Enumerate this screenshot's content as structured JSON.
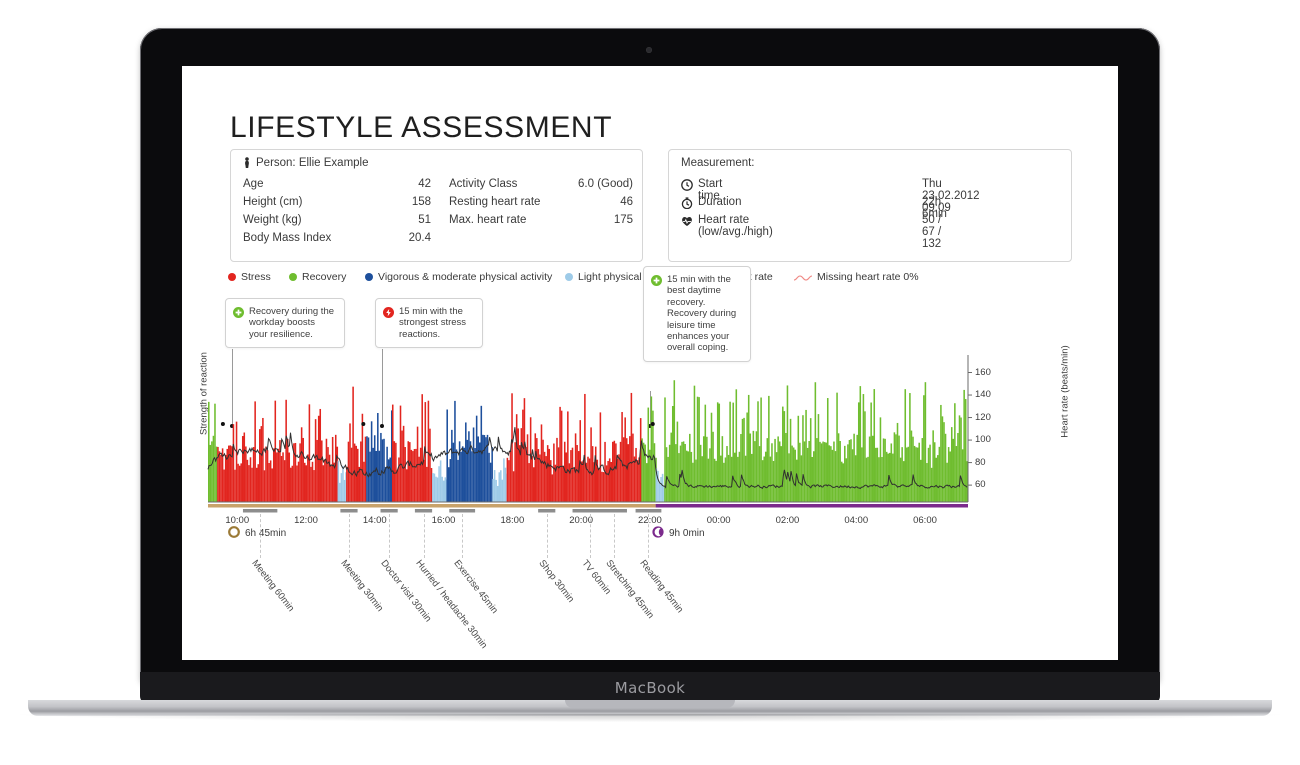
{
  "device": {
    "brand_label": "MacBook"
  },
  "report": {
    "title": "LIFESTYLE ASSESSMENT",
    "person_card": {
      "header": "Person: Ellie Example",
      "person_icon": "person-icon",
      "left_rows": [
        {
          "label": "Age",
          "value": "42"
        },
        {
          "label": "Height (cm)",
          "value": "158"
        },
        {
          "label": "Weight (kg)",
          "value": "51"
        },
        {
          "label": "Body Mass Index",
          "value": "20.4"
        }
      ],
      "right_rows": [
        {
          "label": "Activity Class",
          "value": "6.0 (Good)"
        },
        {
          "label": "Resting heart rate",
          "value": "46"
        },
        {
          "label": "Max. heart rate",
          "value": "175"
        }
      ]
    },
    "measurement_card": {
      "header": "Measurement:",
      "rows": [
        {
          "icon": "clock-icon",
          "label": "Start time",
          "value": "Thu 23.02.2012 09:09"
        },
        {
          "icon": "stopwatch-icon",
          "label": "Duration",
          "value": "22h 6min"
        },
        {
          "icon": "heart-icon",
          "label": "Heart rate (low/avg./high)",
          "value": "50 / 67 / 132"
        }
      ]
    },
    "legend": [
      {
        "marker": "dot",
        "color": "#e2251f",
        "label": "Stress"
      },
      {
        "marker": "dot",
        "color": "#6fbd2f",
        "label": "Recovery"
      },
      {
        "marker": "dot",
        "color": "#1d4f9c",
        "label": "Vigorous & moderate physical activity"
      },
      {
        "marker": "dot",
        "color": "#9ecbe8",
        "label": "Light physical activity"
      },
      {
        "marker": "wave",
        "color": "#303030",
        "label": "Heart rate"
      },
      {
        "marker": "wave",
        "color": "#f08a86",
        "label": "Missing heart rate 0%"
      }
    ],
    "callouts": [
      {
        "icon": "plus-circle-icon",
        "icon_color": "#6fbd2f",
        "text": "Recovery during the workday boosts your resilience."
      },
      {
        "icon": "bolt-circle-icon",
        "icon_color": "#e2251f",
        "text": "15 min with the strongest stress reactions."
      },
      {
        "icon": "plus-circle-icon",
        "icon_color": "#6fbd2f",
        "text": "15 min with the best daytime recovery. Recovery during leisure time enhances your overall coping."
      }
    ],
    "duration_badges": [
      {
        "icon": "awake-ring-icon",
        "color": "#9b7a37",
        "label": "6h 45min"
      },
      {
        "icon": "moon-icon",
        "color": "#7b2a8c",
        "label": "9h 0min"
      }
    ]
  },
  "chart_data": {
    "type": "area",
    "title": "",
    "xlabel": "",
    "ylabel": "Strength of reaction",
    "y2label": "Heart rate (beats/min)",
    "x_ticks": [
      "10:00",
      "12:00",
      "14:00",
      "16:00",
      "18:00",
      "20:00",
      "22:00",
      "00:00",
      "02:00",
      "04:00",
      "06:00"
    ],
    "x_range": [
      "09:09",
      "07:15"
    ],
    "y2_ticks": [
      60,
      80,
      100,
      120,
      140,
      160
    ],
    "y2lim": [
      45,
      172
    ],
    "grid": true,
    "legend_position": "top",
    "series": [
      {
        "name": "Stress",
        "color": "#e2251f"
      },
      {
        "name": "Recovery",
        "color": "#6fbd2f"
      },
      {
        "name": "Vigorous & moderate physical activity",
        "color": "#1d4f9c"
      },
      {
        "name": "Light physical activity",
        "color": "#9ecbe8"
      },
      {
        "name": "Heart rate",
        "color": "#303030",
        "kind": "line"
      },
      {
        "name": "Missing heart rate 0%",
        "color": "#f08a86",
        "kind": "line"
      }
    ],
    "segments": [
      {
        "state": "Recovery",
        "start": "09:09",
        "end": "09:25",
        "color": "#6fbd2f"
      },
      {
        "state": "Stress",
        "start": "09:25",
        "end": "12:55",
        "color": "#e2251f"
      },
      {
        "state": "Light physical activity",
        "start": "12:55",
        "end": "13:10",
        "color": "#9ecbe8"
      },
      {
        "state": "Stress",
        "start": "13:10",
        "end": "13:45",
        "color": "#e2251f"
      },
      {
        "state": "Vigorous & moderate physical activity",
        "start": "13:45",
        "end": "14:30",
        "color": "#1d4f9c"
      },
      {
        "state": "Stress",
        "start": "14:30",
        "end": "15:40",
        "color": "#e2251f"
      },
      {
        "state": "Light physical activity",
        "start": "15:40",
        "end": "16:05",
        "color": "#9ecbe8"
      },
      {
        "state": "Vigorous & moderate physical activity",
        "start": "16:05",
        "end": "17:25",
        "color": "#1d4f9c"
      },
      {
        "state": "Light physical activity",
        "start": "17:25",
        "end": "17:50",
        "color": "#9ecbe8"
      },
      {
        "state": "Stress",
        "start": "17:50",
        "end": "21:45",
        "color": "#e2251f"
      },
      {
        "state": "Recovery",
        "start": "21:45",
        "end": "22:10",
        "color": "#6fbd2f"
      },
      {
        "state": "Light physical activity",
        "start": "22:10",
        "end": "22:25",
        "color": "#9ecbe8"
      },
      {
        "state": "Recovery",
        "start": "22:25",
        "end": "07:15",
        "color": "#6fbd2f"
      }
    ],
    "awake_bar": {
      "label": "6h 45min",
      "start": "09:09",
      "end": "22:10",
      "color": "#c8a26a"
    },
    "sleep_bar": {
      "label": "9h 0min",
      "start": "22:10",
      "end": "07:15",
      "color": "#7b2a8c"
    },
    "events": [
      {
        "label": "Meeting 60min",
        "time": "10:10",
        "duration_min": 60
      },
      {
        "label": "Meeting 30min",
        "time": "13:00",
        "duration_min": 30
      },
      {
        "label": "Doctor visit 30min",
        "time": "14:10",
        "duration_min": 30
      },
      {
        "label": "Hurried / headache 30min",
        "time": "15:10",
        "duration_min": 30
      },
      {
        "label": "Exercise 45min",
        "time": "16:10",
        "duration_min": 45
      },
      {
        "label": "Shop 30min",
        "time": "18:45",
        "duration_min": 30
      },
      {
        "label": "TV 60min",
        "time": "19:45",
        "duration_min": 60
      },
      {
        "label": "Stretching 45min",
        "time": "20:35",
        "duration_min": 45
      },
      {
        "label": "Reading 45min",
        "time": "21:35",
        "duration_min": 45
      }
    ],
    "annotation_markers": [
      {
        "label": "Recovery during the workday boosts your resilience.",
        "time": "09:35"
      },
      {
        "label": "15 min with the strongest stress reactions.",
        "time": "13:40"
      },
      {
        "label": "15 min with the best daytime recovery. Recovery during leisure time enhances your overall coping.",
        "time": "22:05"
      }
    ]
  }
}
